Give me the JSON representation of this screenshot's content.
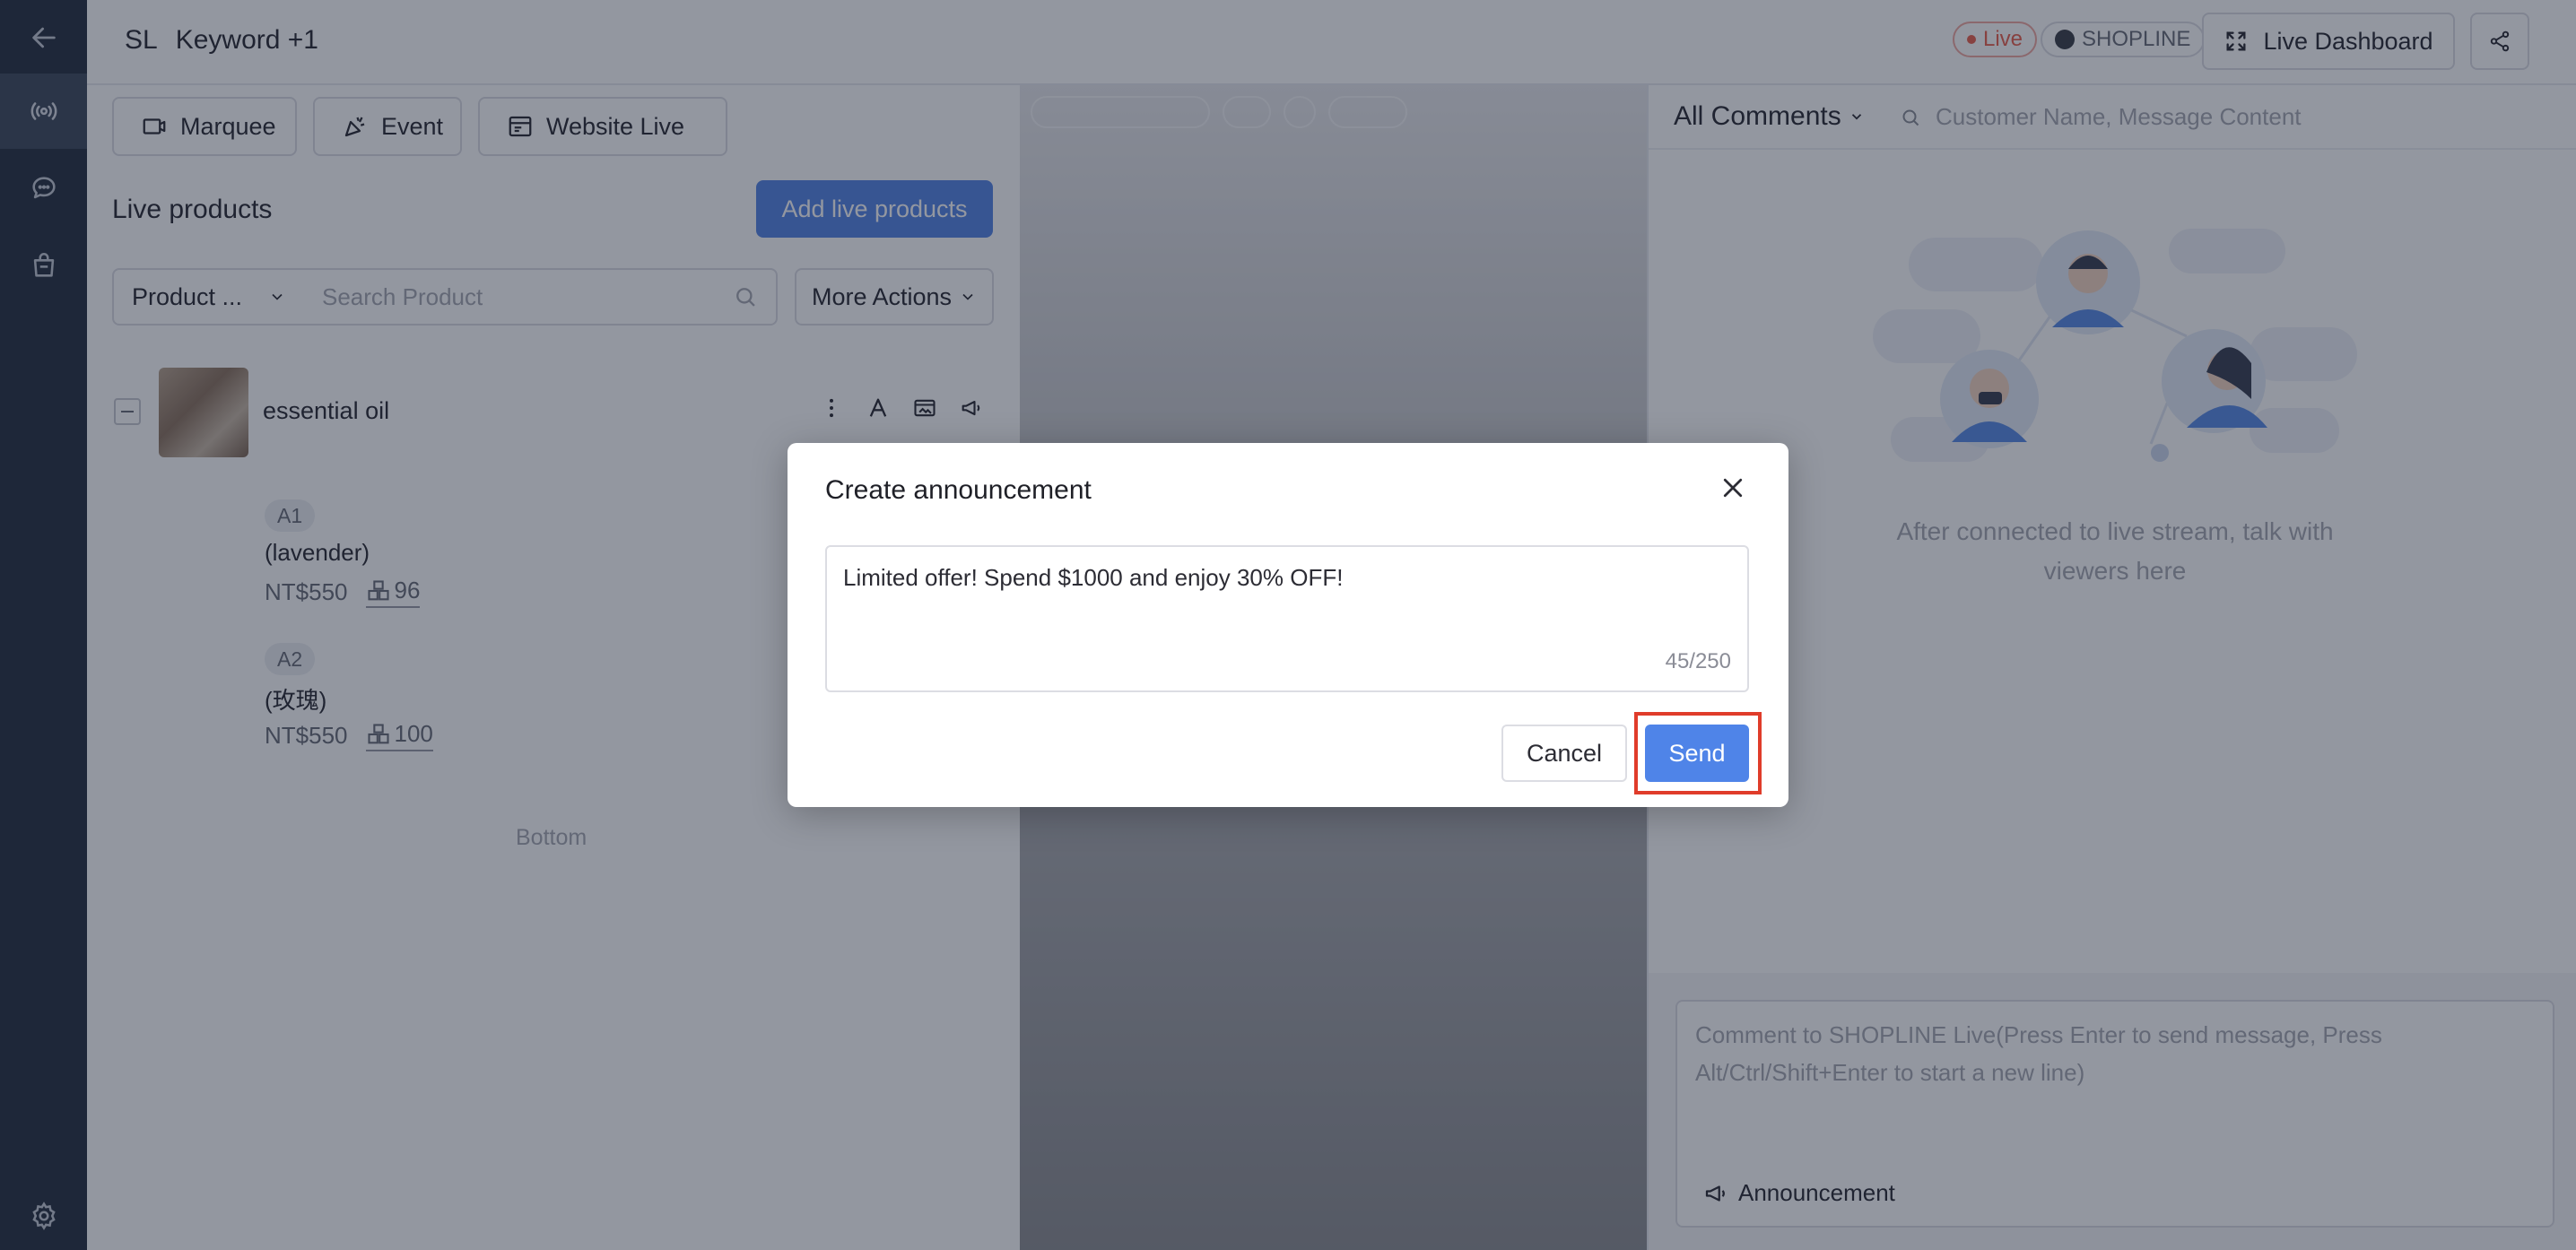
{
  "header": {
    "brand": "SL",
    "title": "Keyword +1",
    "live_badge": "Live",
    "shop_badge": "SHOPLINE",
    "dashboard_button": "Live Dashboard"
  },
  "left_panel": {
    "tabs": [
      "Marquee",
      "Event",
      "Website Live"
    ],
    "live_products_title": "Live products",
    "add_button": "Add live products",
    "filter_select": "Product ...",
    "search_placeholder": "Search Product",
    "more_actions": "More Actions",
    "product": {
      "name": "essential oil",
      "variants": [
        {
          "tag": "A1",
          "name": "(lavender)",
          "price": "NT$550",
          "stock": "96"
        },
        {
          "tag": "A2",
          "name": "(玫瑰)",
          "price": "NT$550",
          "stock": "100"
        }
      ]
    },
    "bottom_text": "Bottom"
  },
  "chat": {
    "filter": "All Comments",
    "search_placeholder": "Customer Name, Message Content",
    "empty_text": "After connected to live stream, talk with viewers here",
    "composer_placeholder": "Comment to SHOPLINE Live(Press Enter to send message, Press Alt/Ctrl/Shift+Enter to start a new line)",
    "announcement_label": "Announcement"
  },
  "modal": {
    "title": "Create announcement",
    "message": "Limited offer! Spend $1000 and enjoy 30% OFF!",
    "char_count": "45/250",
    "cancel_label": "Cancel",
    "send_label": "Send"
  },
  "colors": {
    "sidebar": "#283142",
    "primary": "#4f84e8",
    "live": "#e9614f",
    "highlight": "#e03c2a"
  }
}
